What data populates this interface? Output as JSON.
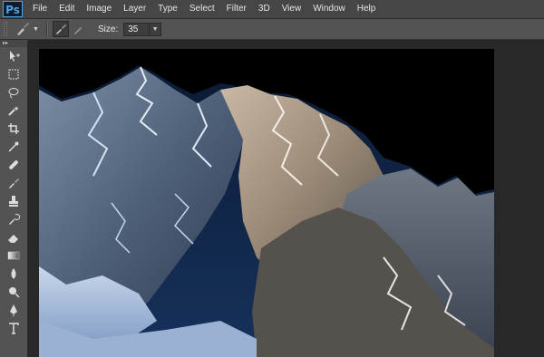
{
  "app": {
    "logo": "Ps"
  },
  "menu": [
    "File",
    "Edit",
    "Image",
    "Layer",
    "Type",
    "Select",
    "Filter",
    "3D",
    "View",
    "Window",
    "Help"
  ],
  "options": {
    "tool_icon": "brush-icon",
    "size_label": "Size:",
    "size_value": "35"
  },
  "tools": [
    "move-icon",
    "marquee-icon",
    "lasso-icon",
    "magic-wand-icon",
    "crop-icon",
    "eyedropper-icon",
    "healing-icon",
    "brush-icon",
    "stamp-icon",
    "history-brush-icon",
    "eraser-icon",
    "gradient-icon",
    "blur-icon",
    "dodge-icon",
    "pen-icon",
    "type-icon"
  ],
  "colors": {
    "accent": "#4ea2e0",
    "menubar": "#464646",
    "panel": "#535353",
    "canvas_bg": "#000000",
    "sky": "#0f2547",
    "rock": "#8a8a86",
    "snow": "#e8eef6"
  }
}
